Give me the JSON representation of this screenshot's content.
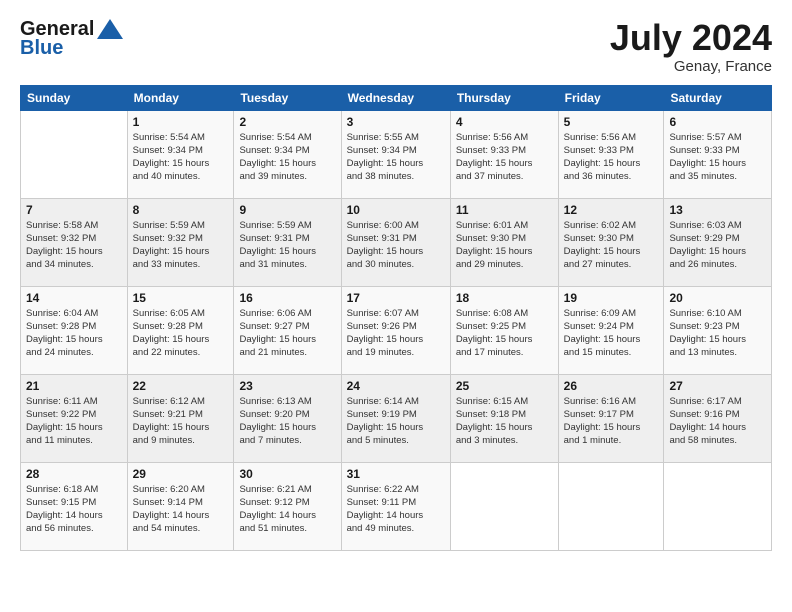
{
  "header": {
    "logo_line1": "General",
    "logo_line2": "Blue",
    "month_year": "July 2024",
    "location": "Genay, France"
  },
  "weekdays": [
    "Sunday",
    "Monday",
    "Tuesday",
    "Wednesday",
    "Thursday",
    "Friday",
    "Saturday"
  ],
  "weeks": [
    [
      {
        "day": "",
        "info": ""
      },
      {
        "day": "1",
        "info": "Sunrise: 5:54 AM\nSunset: 9:34 PM\nDaylight: 15 hours\nand 40 minutes."
      },
      {
        "day": "2",
        "info": "Sunrise: 5:54 AM\nSunset: 9:34 PM\nDaylight: 15 hours\nand 39 minutes."
      },
      {
        "day": "3",
        "info": "Sunrise: 5:55 AM\nSunset: 9:34 PM\nDaylight: 15 hours\nand 38 minutes."
      },
      {
        "day": "4",
        "info": "Sunrise: 5:56 AM\nSunset: 9:33 PM\nDaylight: 15 hours\nand 37 minutes."
      },
      {
        "day": "5",
        "info": "Sunrise: 5:56 AM\nSunset: 9:33 PM\nDaylight: 15 hours\nand 36 minutes."
      },
      {
        "day": "6",
        "info": "Sunrise: 5:57 AM\nSunset: 9:33 PM\nDaylight: 15 hours\nand 35 minutes."
      }
    ],
    [
      {
        "day": "7",
        "info": "Sunrise: 5:58 AM\nSunset: 9:32 PM\nDaylight: 15 hours\nand 34 minutes."
      },
      {
        "day": "8",
        "info": "Sunrise: 5:59 AM\nSunset: 9:32 PM\nDaylight: 15 hours\nand 33 minutes."
      },
      {
        "day": "9",
        "info": "Sunrise: 5:59 AM\nSunset: 9:31 PM\nDaylight: 15 hours\nand 31 minutes."
      },
      {
        "day": "10",
        "info": "Sunrise: 6:00 AM\nSunset: 9:31 PM\nDaylight: 15 hours\nand 30 minutes."
      },
      {
        "day": "11",
        "info": "Sunrise: 6:01 AM\nSunset: 9:30 PM\nDaylight: 15 hours\nand 29 minutes."
      },
      {
        "day": "12",
        "info": "Sunrise: 6:02 AM\nSunset: 9:30 PM\nDaylight: 15 hours\nand 27 minutes."
      },
      {
        "day": "13",
        "info": "Sunrise: 6:03 AM\nSunset: 9:29 PM\nDaylight: 15 hours\nand 26 minutes."
      }
    ],
    [
      {
        "day": "14",
        "info": "Sunrise: 6:04 AM\nSunset: 9:28 PM\nDaylight: 15 hours\nand 24 minutes."
      },
      {
        "day": "15",
        "info": "Sunrise: 6:05 AM\nSunset: 9:28 PM\nDaylight: 15 hours\nand 22 minutes."
      },
      {
        "day": "16",
        "info": "Sunrise: 6:06 AM\nSunset: 9:27 PM\nDaylight: 15 hours\nand 21 minutes."
      },
      {
        "day": "17",
        "info": "Sunrise: 6:07 AM\nSunset: 9:26 PM\nDaylight: 15 hours\nand 19 minutes."
      },
      {
        "day": "18",
        "info": "Sunrise: 6:08 AM\nSunset: 9:25 PM\nDaylight: 15 hours\nand 17 minutes."
      },
      {
        "day": "19",
        "info": "Sunrise: 6:09 AM\nSunset: 9:24 PM\nDaylight: 15 hours\nand 15 minutes."
      },
      {
        "day": "20",
        "info": "Sunrise: 6:10 AM\nSunset: 9:23 PM\nDaylight: 15 hours\nand 13 minutes."
      }
    ],
    [
      {
        "day": "21",
        "info": "Sunrise: 6:11 AM\nSunset: 9:22 PM\nDaylight: 15 hours\nand 11 minutes."
      },
      {
        "day": "22",
        "info": "Sunrise: 6:12 AM\nSunset: 9:21 PM\nDaylight: 15 hours\nand 9 minutes."
      },
      {
        "day": "23",
        "info": "Sunrise: 6:13 AM\nSunset: 9:20 PM\nDaylight: 15 hours\nand 7 minutes."
      },
      {
        "day": "24",
        "info": "Sunrise: 6:14 AM\nSunset: 9:19 PM\nDaylight: 15 hours\nand 5 minutes."
      },
      {
        "day": "25",
        "info": "Sunrise: 6:15 AM\nSunset: 9:18 PM\nDaylight: 15 hours\nand 3 minutes."
      },
      {
        "day": "26",
        "info": "Sunrise: 6:16 AM\nSunset: 9:17 PM\nDaylight: 15 hours\nand 1 minute."
      },
      {
        "day": "27",
        "info": "Sunrise: 6:17 AM\nSunset: 9:16 PM\nDaylight: 14 hours\nand 58 minutes."
      }
    ],
    [
      {
        "day": "28",
        "info": "Sunrise: 6:18 AM\nSunset: 9:15 PM\nDaylight: 14 hours\nand 56 minutes."
      },
      {
        "day": "29",
        "info": "Sunrise: 6:20 AM\nSunset: 9:14 PM\nDaylight: 14 hours\nand 54 minutes."
      },
      {
        "day": "30",
        "info": "Sunrise: 6:21 AM\nSunset: 9:12 PM\nDaylight: 14 hours\nand 51 minutes."
      },
      {
        "day": "31",
        "info": "Sunrise: 6:22 AM\nSunset: 9:11 PM\nDaylight: 14 hours\nand 49 minutes."
      },
      {
        "day": "",
        "info": ""
      },
      {
        "day": "",
        "info": ""
      },
      {
        "day": "",
        "info": ""
      }
    ]
  ]
}
